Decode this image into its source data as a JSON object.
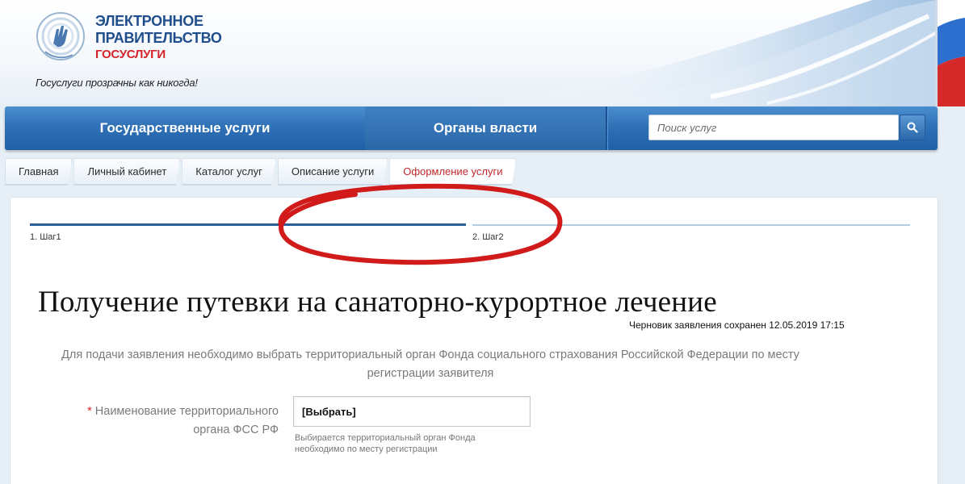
{
  "header": {
    "logo_line1": "ЭЛЕКТРОННОЕ",
    "logo_line2": "ПРАВИТЕЛЬСТВО",
    "logo_line3": "ГОСУСЛУГИ",
    "slogan": "Госуслуги прозрачны как никогда!",
    "colors": {
      "brand_blue": "#1f4e8c",
      "brand_red": "#d6232a"
    }
  },
  "topnav": {
    "tabs": [
      {
        "label": "Государственные услуги"
      },
      {
        "label": "Органы власти"
      }
    ],
    "search": {
      "placeholder": "Поиск услуг",
      "icon": "magnifier-icon"
    }
  },
  "breadcrumbs": [
    {
      "label": "Главная"
    },
    {
      "label": "Личный кабинет"
    },
    {
      "label": "Каталог услуг"
    },
    {
      "label": "Описание услуги"
    },
    {
      "label": "Оформление услуги",
      "active": true
    }
  ],
  "steps": [
    {
      "label": "1. Шаг1",
      "active": true
    },
    {
      "label": "2. Шаг2",
      "active": false
    }
  ],
  "page": {
    "title": "Получение путевки на санаторно-курортное лечение",
    "draft_saved": "Черновик заявления сохранен 12.05.2019 17:15",
    "intro": "Для подачи заявления необходимо выбрать территориальный орган Фонда социального страхования Российской Федерации по месту регистрации заявителя"
  },
  "form": {
    "required_mark": "*",
    "field_label": "Наименование территориального органа ФСС РФ",
    "select_value": "[Выбрать]",
    "hint": "Выбирается территориальный орган Фонда необходимо по месту регистрации"
  },
  "annotation": {
    "color": "#d11a1a"
  }
}
